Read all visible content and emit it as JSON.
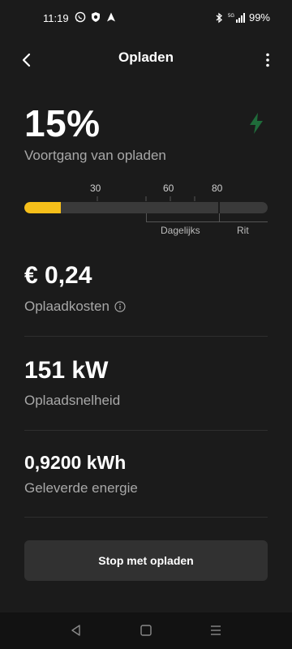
{
  "status_bar": {
    "time": "11:19",
    "left_icons": [
      "whatsapp-icon",
      "shield-icon",
      "navigation-arrow-icon"
    ],
    "right_icons": [
      "bluetooth-icon",
      "5g-signal-icon"
    ],
    "network": "5G",
    "battery": "99%"
  },
  "header": {
    "title": "Opladen",
    "back_icon": "chevron-left-icon",
    "menu_icon": "more-vertical-icon"
  },
  "charge": {
    "percent_text": "15%",
    "percent_value": 15,
    "label": "Voortgang van opladen",
    "status_icon": "lightning-bolt-icon",
    "status_color": "#1f6b3a",
    "fill_color": "#f6bf1a",
    "scale_labels": [
      "30",
      "60",
      "80"
    ],
    "limit_value": 80,
    "range_labels": {
      "daily": "Dagelijks",
      "trip": "Rit"
    }
  },
  "stats": {
    "cost": {
      "value": "€ 0,24",
      "label": "Oplaadkosten",
      "info_icon": "info-icon"
    },
    "speed": {
      "value": "151 kW",
      "label": "Oplaadsnelheid"
    },
    "energy": {
      "value": "0,9200 kWh",
      "label": "Geleverde energie"
    }
  },
  "actions": {
    "stop_label": "Stop met opladen"
  },
  "nav_bar": {
    "icons": [
      "back-triangle-icon",
      "home-square-icon",
      "recents-menu-icon"
    ]
  }
}
